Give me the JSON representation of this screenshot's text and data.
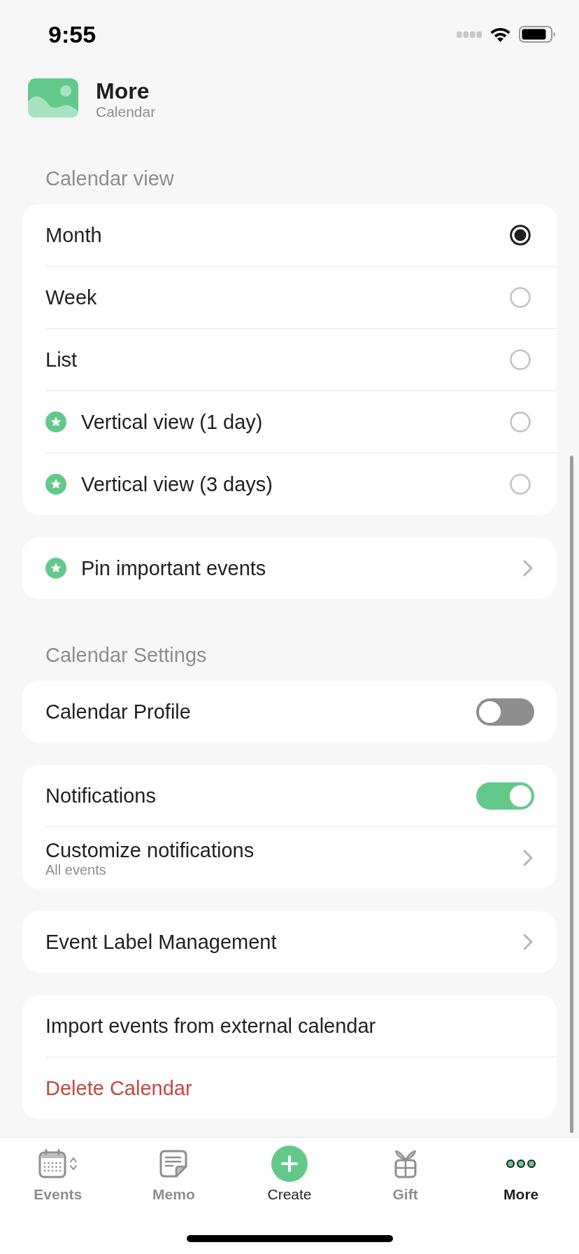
{
  "status_bar": {
    "time": "9:55"
  },
  "header": {
    "title": "More",
    "subtitle": "Calendar"
  },
  "sections": [
    {
      "title": "Calendar view",
      "cards": [
        {
          "rows": [
            {
              "kind": "radio",
              "label": "Month",
              "premium": false,
              "selected": true
            },
            {
              "kind": "radio",
              "label": "Week",
              "premium": false,
              "selected": false
            },
            {
              "kind": "radio",
              "label": "List",
              "premium": false,
              "selected": false
            },
            {
              "kind": "radio",
              "label": "Vertical view (1 day)",
              "premium": true,
              "selected": false
            },
            {
              "kind": "radio",
              "label": "Vertical view (3 days)",
              "premium": true,
              "selected": false
            }
          ]
        },
        {
          "rows": [
            {
              "kind": "link",
              "label": "Pin important events",
              "premium": true
            }
          ]
        }
      ]
    },
    {
      "title": "Calendar Settings",
      "cards": [
        {
          "rows": [
            {
              "kind": "toggle",
              "label": "Calendar Profile",
              "premium": false,
              "on": false
            }
          ]
        },
        {
          "rows": [
            {
              "kind": "toggle",
              "label": "Notifications",
              "premium": false,
              "on": true
            },
            {
              "kind": "link",
              "label": "Customize notifications",
              "premium": false,
              "sublabel": "All events"
            }
          ]
        },
        {
          "rows": [
            {
              "kind": "link",
              "label": "Event Label Management",
              "premium": false
            }
          ]
        },
        {
          "rows": [
            {
              "kind": "action",
              "label": "Import events from external calendar",
              "premium": false
            },
            {
              "kind": "danger",
              "label": "Delete Calendar",
              "premium": false
            }
          ]
        }
      ]
    }
  ],
  "tab_bar": [
    {
      "kind": "tab",
      "label": "Events",
      "selected": false
    },
    {
      "kind": "tab",
      "label": "Memo",
      "selected": false
    },
    {
      "kind": "create",
      "label": "Create",
      "selected": false
    },
    {
      "kind": "tab",
      "label": "Gift",
      "selected": false
    },
    {
      "kind": "tab",
      "label": "More",
      "selected": true
    }
  ]
}
